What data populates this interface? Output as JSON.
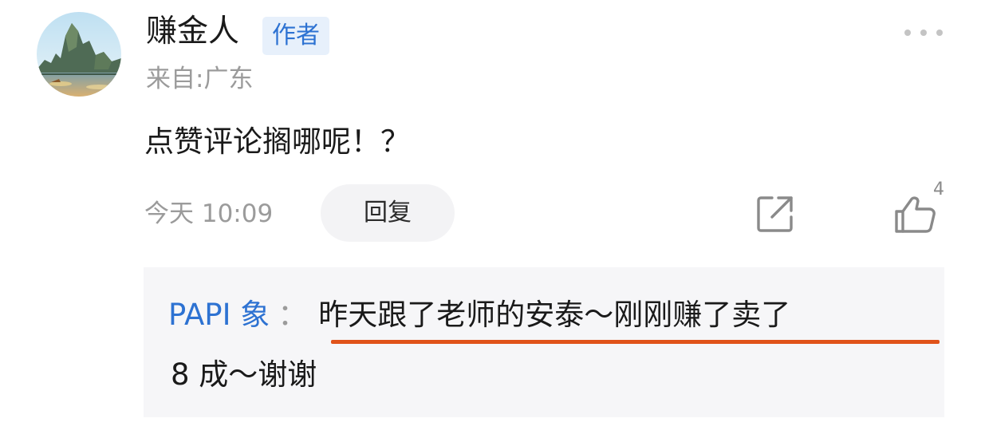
{
  "comment": {
    "username": "赚金人",
    "author_badge": "作者",
    "location": "来自:广东",
    "text": "点赞评论搁哪呢！？",
    "timestamp": "今天 10:09",
    "reply_label": "回复",
    "like_count": "4"
  },
  "reply": {
    "user": "PAPI 象",
    "separator": "：",
    "text_line1": "昨天跟了老师的安泰～刚刚赚了卖了",
    "text_line2": "8 成～谢谢"
  },
  "icons": {
    "more": "more-dots-icon",
    "share": "share-icon",
    "like": "thumbs-up-icon"
  },
  "colors": {
    "accent_blue": "#2d72d2",
    "badge_bg": "#e7f0fb",
    "annotation_underline": "#e0531a",
    "reply_box_bg": "#f6f6f8",
    "muted_text": "#9b9b9b"
  }
}
